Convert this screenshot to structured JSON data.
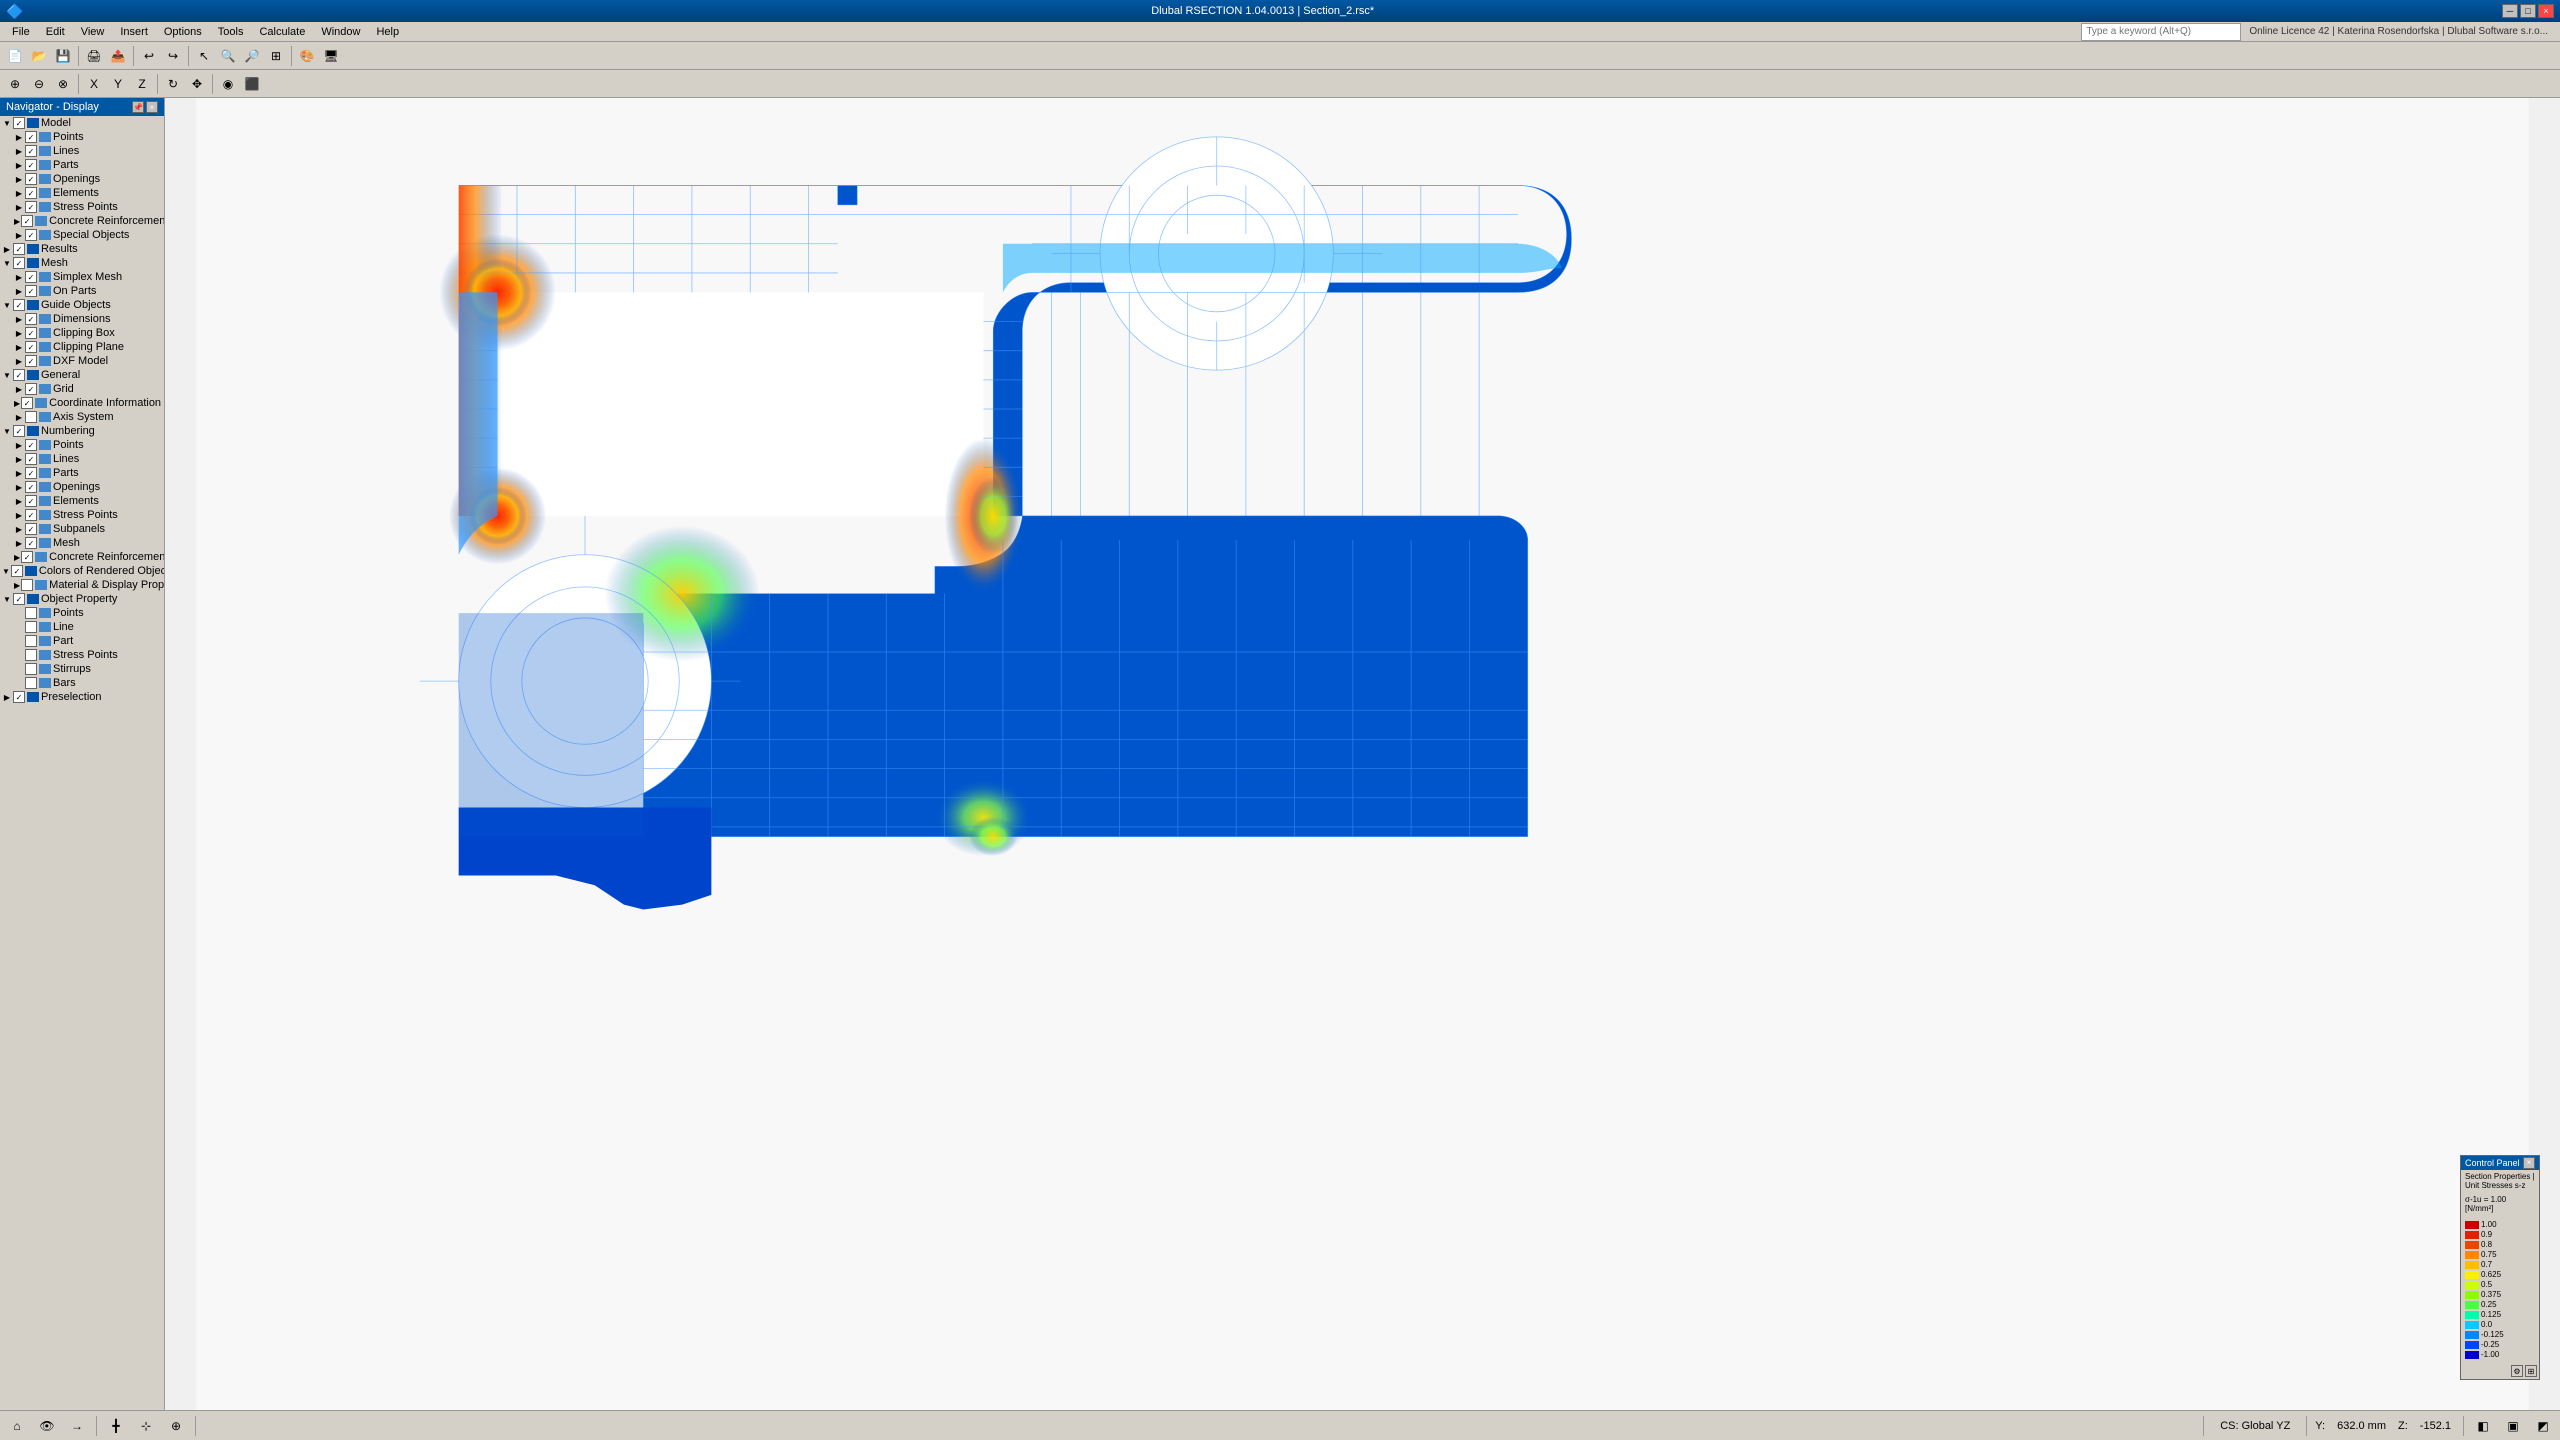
{
  "titlebar": {
    "title": "Dlubal RSECTION 1.04.0013 | Section_2.rsc*",
    "minimize": "─",
    "maximize": "□",
    "close": "×"
  },
  "menubar": {
    "items": [
      "File",
      "Edit",
      "View",
      "Insert",
      "Options",
      "Tools",
      "Calculate",
      "Window",
      "Help"
    ]
  },
  "toolbar": {
    "search_placeholder": "Type a keyword (Alt+Q)",
    "license_info": "Online Licence 42 | Katerina Rosendorfska | Dlubal Software s.r.o..."
  },
  "navigator": {
    "header": "Navigator - Display",
    "tree": [
      {
        "indent": 0,
        "label": "Model",
        "has_check": true,
        "expanded": true,
        "arrow": "▼"
      },
      {
        "indent": 1,
        "label": "Points",
        "has_check": true,
        "expanded": true,
        "arrow": "▶"
      },
      {
        "indent": 1,
        "label": "Lines",
        "has_check": true,
        "expanded": false,
        "arrow": "▶"
      },
      {
        "indent": 1,
        "label": "Parts",
        "has_check": true,
        "expanded": false,
        "arrow": "▶"
      },
      {
        "indent": 1,
        "label": "Openings",
        "has_check": true,
        "expanded": false,
        "arrow": "▶"
      },
      {
        "indent": 1,
        "label": "Elements",
        "has_check": true,
        "expanded": false,
        "arrow": "▶"
      },
      {
        "indent": 1,
        "label": "Stress Points",
        "has_check": true,
        "expanded": false,
        "arrow": "▶"
      },
      {
        "indent": 1,
        "label": "Concrete Reinforcement",
        "has_check": true,
        "expanded": false,
        "arrow": "▶"
      },
      {
        "indent": 1,
        "label": "Special Objects",
        "has_check": true,
        "expanded": false,
        "arrow": "▶"
      },
      {
        "indent": 0,
        "label": "Results",
        "has_check": true,
        "expanded": false,
        "arrow": "▶"
      },
      {
        "indent": 0,
        "label": "Mesh",
        "has_check": true,
        "expanded": true,
        "arrow": "▼"
      },
      {
        "indent": 1,
        "label": "Simplex Mesh",
        "has_check": true,
        "expanded": false,
        "arrow": "▶"
      },
      {
        "indent": 1,
        "label": "On Parts",
        "has_check": true,
        "expanded": false,
        "arrow": "▶"
      },
      {
        "indent": 0,
        "label": "Guide Objects",
        "has_check": true,
        "expanded": true,
        "arrow": "▼"
      },
      {
        "indent": 1,
        "label": "Dimensions",
        "has_check": true,
        "expanded": false,
        "arrow": "▶"
      },
      {
        "indent": 1,
        "label": "Clipping Box",
        "has_check": true,
        "expanded": false,
        "arrow": "▶"
      },
      {
        "indent": 1,
        "label": "Clipping Plane",
        "has_check": true,
        "expanded": false,
        "arrow": "▶"
      },
      {
        "indent": 1,
        "label": "DXF Model",
        "has_check": true,
        "expanded": false,
        "arrow": "▶"
      },
      {
        "indent": 0,
        "label": "General",
        "has_check": true,
        "expanded": true,
        "arrow": "▼"
      },
      {
        "indent": 1,
        "label": "Grid",
        "has_check": true,
        "expanded": false,
        "arrow": "▶"
      },
      {
        "indent": 1,
        "label": "Coordinate Information on Cursor",
        "has_check": true,
        "expanded": false,
        "arrow": "▶"
      },
      {
        "indent": 1,
        "label": "Axis System",
        "has_check": false,
        "expanded": false,
        "arrow": "▶"
      },
      {
        "indent": 0,
        "label": "Numbering",
        "has_check": true,
        "expanded": true,
        "arrow": "▼"
      },
      {
        "indent": 1,
        "label": "Points",
        "has_check": true,
        "expanded": false,
        "arrow": "▶"
      },
      {
        "indent": 1,
        "label": "Lines",
        "has_check": true,
        "expanded": false,
        "arrow": "▶"
      },
      {
        "indent": 1,
        "label": "Parts",
        "has_check": true,
        "expanded": false,
        "arrow": "▶"
      },
      {
        "indent": 1,
        "label": "Openings",
        "has_check": true,
        "expanded": false,
        "arrow": "▶"
      },
      {
        "indent": 1,
        "label": "Elements",
        "has_check": true,
        "expanded": false,
        "arrow": "▶"
      },
      {
        "indent": 1,
        "label": "Stress Points",
        "has_check": true,
        "expanded": false,
        "arrow": "▶"
      },
      {
        "indent": 1,
        "label": "Subpanels",
        "has_check": true,
        "expanded": false,
        "arrow": "▶"
      },
      {
        "indent": 1,
        "label": "Mesh",
        "has_check": true,
        "expanded": false,
        "arrow": "▶"
      },
      {
        "indent": 1,
        "label": "Concrete Reinforcement",
        "has_check": true,
        "expanded": false,
        "arrow": "▶"
      },
      {
        "indent": 0,
        "label": "Colors of Rendered Objects by",
        "has_check": true,
        "expanded": true,
        "arrow": "▼"
      },
      {
        "indent": 1,
        "label": "Material & Display Properties",
        "has_check": false,
        "expanded": false,
        "arrow": "▶"
      },
      {
        "indent": 0,
        "label": "Object Property",
        "has_check": true,
        "expanded": true,
        "arrow": "▼"
      },
      {
        "indent": 1,
        "label": "Points",
        "has_check": false,
        "expanded": false,
        "arrow": ""
      },
      {
        "indent": 1,
        "label": "Line",
        "has_check": false,
        "expanded": false,
        "arrow": ""
      },
      {
        "indent": 1,
        "label": "Part",
        "has_check": false,
        "expanded": false,
        "arrow": ""
      },
      {
        "indent": 1,
        "label": "Stress Points",
        "has_check": false,
        "expanded": false,
        "arrow": ""
      },
      {
        "indent": 1,
        "label": "Stirrups",
        "has_check": false,
        "expanded": false,
        "arrow": ""
      },
      {
        "indent": 1,
        "label": "Bars",
        "has_check": false,
        "expanded": false,
        "arrow": ""
      },
      {
        "indent": 0,
        "label": "Preselection",
        "has_check": true,
        "expanded": false,
        "arrow": "▶"
      }
    ]
  },
  "control_panel": {
    "header": "Control Panel",
    "subtitle": "Section Properties | Unit Stresses s-z",
    "subtitle2": "σ-1u = 1.00 [N/mm²]",
    "close_btn": "×",
    "legend": [
      {
        "color": "#cc0000",
        "value": "1.00"
      },
      {
        "color": "#dd2200",
        "value": "0.9"
      },
      {
        "color": "#ee4400",
        "value": "0.8"
      },
      {
        "color": "#ff8800",
        "value": "0.75"
      },
      {
        "color": "#ffbb00",
        "value": "0.7"
      },
      {
        "color": "#ffee00",
        "value": "0.625"
      },
      {
        "color": "#ccff00",
        "value": "0.5"
      },
      {
        "color": "#88ff00",
        "value": "0.375"
      },
      {
        "color": "#44ff44",
        "value": "0.25"
      },
      {
        "color": "#00ffaa",
        "value": "0.125"
      },
      {
        "color": "#00ccff",
        "value": "0.0"
      },
      {
        "color": "#0088ff",
        "value": "-0.125"
      },
      {
        "color": "#0044ff",
        "value": "-0.25"
      },
      {
        "color": "#0000cc",
        "value": "-1.00"
      }
    ]
  },
  "statusbar": {
    "cs_label": "CS: Global YZ",
    "x_label": "Y:",
    "x_value": "632.0 mm",
    "z_label": "Z:",
    "z_value": "-152.1"
  }
}
